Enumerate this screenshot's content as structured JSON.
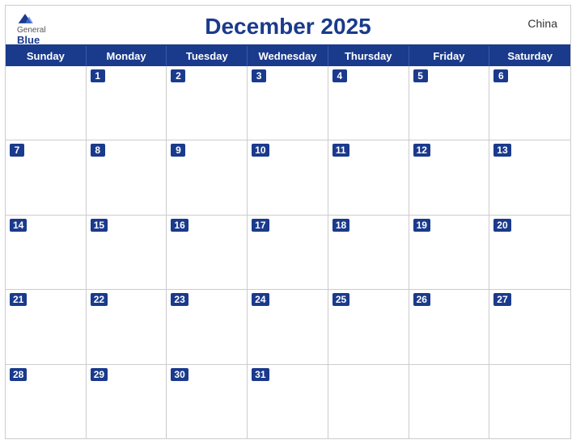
{
  "header": {
    "title": "December 2025",
    "country": "China",
    "logo_general": "General",
    "logo_blue": "Blue"
  },
  "days_of_week": [
    "Sunday",
    "Monday",
    "Tuesday",
    "Wednesday",
    "Thursday",
    "Friday",
    "Saturday"
  ],
  "weeks": [
    [
      null,
      1,
      2,
      3,
      4,
      5,
      6
    ],
    [
      7,
      8,
      9,
      10,
      11,
      12,
      13
    ],
    [
      14,
      15,
      16,
      17,
      18,
      19,
      20
    ],
    [
      21,
      22,
      23,
      24,
      25,
      26,
      27
    ],
    [
      28,
      29,
      30,
      31,
      null,
      null,
      null
    ]
  ]
}
